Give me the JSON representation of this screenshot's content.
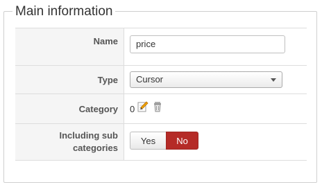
{
  "section": {
    "title": "Main information"
  },
  "fields": {
    "name": {
      "label": "Name",
      "value": "price"
    },
    "type": {
      "label": "Type",
      "selected": "Cursor"
    },
    "category": {
      "label": "Category",
      "value": "0",
      "edit_icon": "pencil-edit-icon",
      "clear_icon": "clear-icon"
    },
    "including_sub": {
      "label_line1": "Including sub",
      "label_line2": "categories",
      "yes_label": "Yes",
      "no_label": "No",
      "selected": "No"
    }
  },
  "colors": {
    "active_toggle": "#b52b27"
  }
}
